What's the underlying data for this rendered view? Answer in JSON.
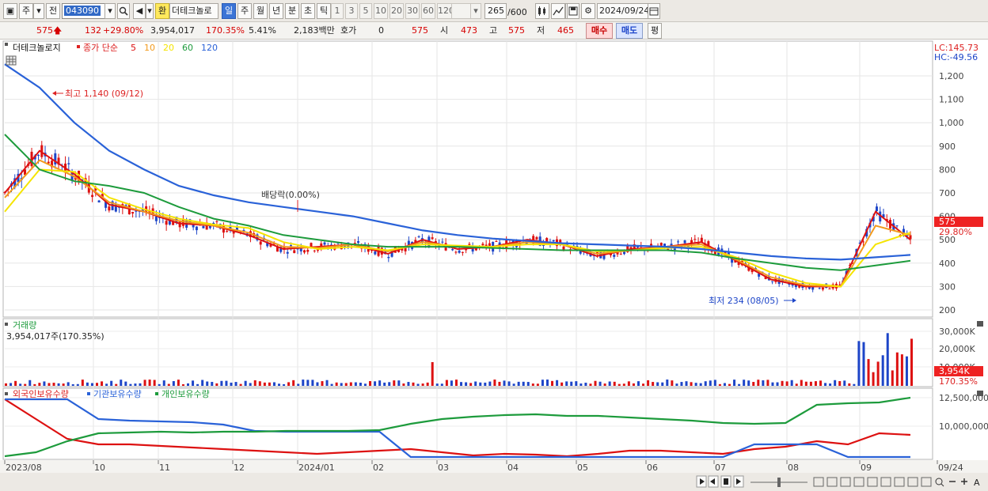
{
  "toolbar": {
    "period_main": "주",
    "prev_label": "전",
    "code": "043090",
    "exchange_badge": "환",
    "stock_name": "더테크놀로",
    "periods": [
      "일",
      "주",
      "월",
      "년",
      "분",
      "초",
      "틱"
    ],
    "active_period": "일",
    "intervals": [
      "1",
      "3",
      "5",
      "10",
      "20",
      "30",
      "60",
      "120"
    ],
    "page_count": "265",
    "page_total": "/600",
    "date": "2024/09/24"
  },
  "quote": {
    "price": "575",
    "arrow": "🡅",
    "change": "132",
    "change_pct": "+29.80%",
    "volume": "3,954,017",
    "volume_ratio": "170.35%",
    "turnover": "5.41%",
    "amount": "2,183백만",
    "hoga_label": "호가",
    "hoga_value": "0",
    "hoga_price": "575",
    "open_label": "시",
    "open": "473",
    "high_label": "고",
    "high": "575",
    "low_label": "저",
    "low": "465",
    "buy_label": "매수",
    "sell_label": "매도",
    "eval_label": "평"
  },
  "price_panel": {
    "title": "더테크놀로지",
    "ma_label": "종가 단순",
    "ma_periods": [
      "5",
      "10",
      "20",
      "60",
      "120"
    ],
    "ma_colors": [
      "#dd1111",
      "#f29a1d",
      "#f5e400",
      "#1d9b3c",
      "#2a62d8"
    ],
    "lc": "LC:145.73",
    "hc": "HC:-49.56",
    "y_ticks": [
      "1,200",
      "1,100",
      "1,000",
      "900",
      "800",
      "700",
      "600",
      "500",
      "400",
      "300",
      "200"
    ],
    "max_note": "최고 1,140 (09/12)",
    "min_note": "최저 234 (08/05)",
    "event_note": "배당락(0.00%)",
    "last_price": "575",
    "last_pct": "29.80%"
  },
  "volume_panel": {
    "title": "거래량",
    "value": "3,954,017주(170.35%)",
    "y_ticks": [
      "30,000K",
      "20,000K",
      "10,000K"
    ],
    "last_volume": "3,954K",
    "last_ratio": "170.35%"
  },
  "holder_panel": {
    "foreign": "외국인보유수량",
    "institution": "기관보유수량",
    "individual": "개인보유수량",
    "y_ticks": [
      "12,500,000",
      "10,000,000"
    ]
  },
  "x_axis": [
    "2023/08",
    "10",
    "11",
    "12",
    "2024/01",
    "02",
    "03",
    "04",
    "05",
    "06",
    "07",
    "08",
    "09",
    "09/24"
  ],
  "chart_data": {
    "type": "candlestick",
    "title": "더테크놀로지",
    "ylim": [
      200,
      1250
    ],
    "x": [
      "2023/08",
      "10",
      "11",
      "12",
      "2024/01",
      "02",
      "03",
      "04",
      "05",
      "06",
      "07",
      "08",
      "09"
    ],
    "series": [
      {
        "name": "5",
        "values": [
          700,
          880,
          780,
          650,
          620,
          570,
          560,
          520,
          460,
          470,
          480,
          440,
          500,
          460,
          470,
          500,
          480,
          430,
          460,
          470,
          490,
          410,
          330,
          300,
          300,
          620,
          500
        ]
      },
      {
        "name": "10",
        "values": [
          680,
          840,
          770,
          660,
          620,
          580,
          560,
          530,
          470,
          465,
          480,
          450,
          490,
          470,
          470,
          490,
          480,
          440,
          455,
          470,
          480,
          415,
          340,
          305,
          300,
          560,
          520
        ]
      },
      {
        "name": "20",
        "values": [
          620,
          800,
          790,
          680,
          630,
          590,
          565,
          550,
          490,
          460,
          470,
          455,
          480,
          475,
          470,
          480,
          480,
          450,
          455,
          465,
          470,
          425,
          360,
          315,
          300,
          480,
          530
        ]
      },
      {
        "name": "60",
        "values": [
          950,
          800,
          750,
          730,
          700,
          640,
          590,
          560,
          520,
          500,
          480,
          470,
          470,
          470,
          465,
          460,
          455,
          455,
          455,
          455,
          445,
          420,
          400,
          380,
          370,
          390,
          410
        ]
      },
      {
        "name": "120",
        "values": [
          1250,
          1150,
          1000,
          880,
          800,
          730,
          690,
          660,
          640,
          620,
          600,
          570,
          540,
          520,
          505,
          495,
          485,
          480,
          475,
          470,
          460,
          445,
          430,
          420,
          415,
          425,
          435
        ]
      }
    ]
  }
}
